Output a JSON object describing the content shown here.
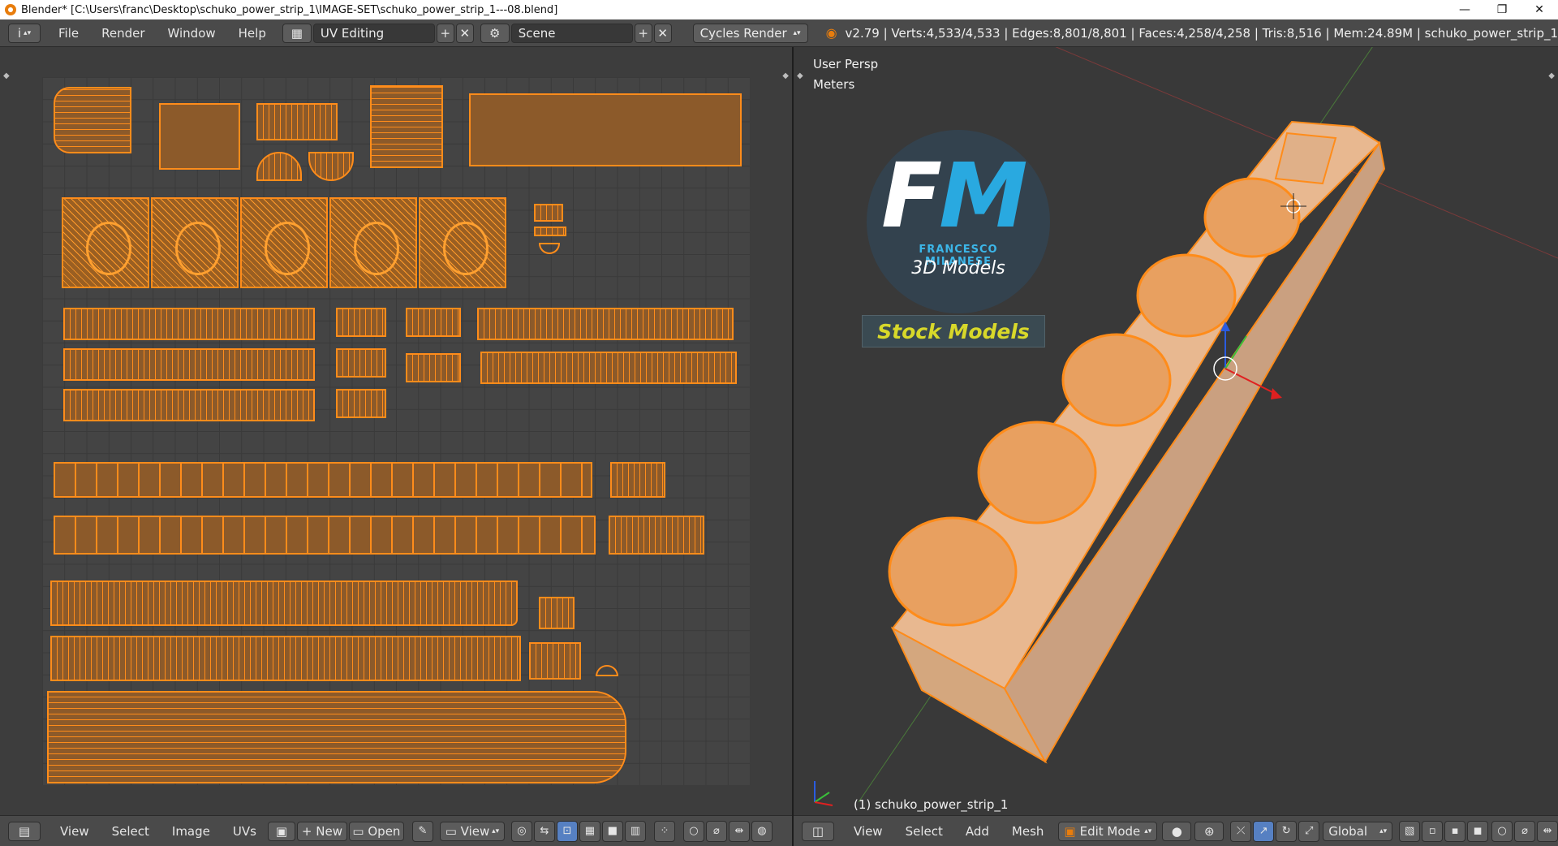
{
  "window": {
    "title": "Blender* [C:\\Users\\franc\\Desktop\\schuko_power_strip_1\\IMAGE-SET\\schuko_power_strip_1---08.blend]",
    "minimize": "—",
    "maximize": "❐",
    "close": "✕"
  },
  "info_header": {
    "editor_icon": "i",
    "menus": [
      "File",
      "Render",
      "Window",
      "Help"
    ],
    "screen_layout": "UV Editing",
    "scene": "Scene",
    "render_engine": "Cycles Render",
    "stats": "v2.79 | Verts:4,533/4,533 | Edges:8,801/8,801 | Faces:4,258/4,258 | Tris:8,516 | Mem:24.89M | schuko_power_strip_1"
  },
  "viewport": {
    "view_name": "User Persp",
    "units": "Meters",
    "object_label": "(1) schuko_power_strip_1",
    "logo": {
      "initials_f": "F",
      "initials_m": "M",
      "name": "FRANCESCO MILANESE",
      "tagline": "3D Models",
      "banner": "Stock Models"
    }
  },
  "uv_footer": {
    "menus": [
      "View",
      "Select",
      "Image",
      "UVs"
    ],
    "new_label": "New",
    "open_label": "Open",
    "view_label": "View"
  },
  "viewport_footer": {
    "menus": [
      "View",
      "Select",
      "Add",
      "Mesh"
    ],
    "mode": "Edit Mode",
    "orientation": "Global"
  },
  "colors": {
    "accent_orange": "#ff8c1a",
    "blender_bg": "#393939",
    "header_bg": "#4a4a4a"
  }
}
